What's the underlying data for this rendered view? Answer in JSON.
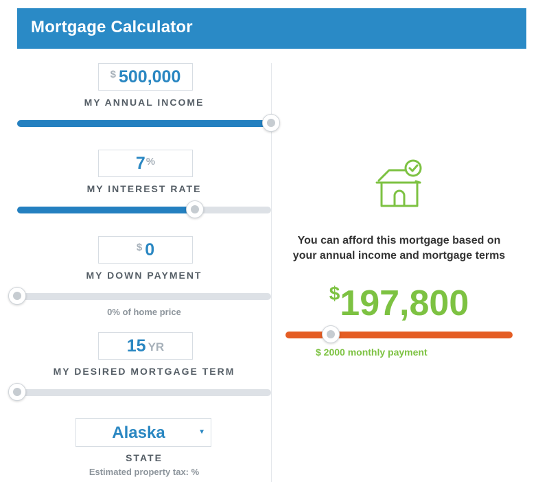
{
  "header": {
    "title": "Mortgage Calculator"
  },
  "colors": {
    "primary": "#2a8ac6",
    "slider_fill": "#2480c0",
    "track": "#dde1e6",
    "success": "#7dc242",
    "orange": "#e45d24",
    "value_blue": "#2a87c2"
  },
  "income": {
    "prefix": "$",
    "value": "500,000",
    "label": "MY ANNUAL INCOME",
    "slider_fraction": 1.0
  },
  "interest": {
    "value": "7",
    "suffix": "%",
    "label": "MY INTEREST RATE",
    "slider_fraction": 0.7
  },
  "down_payment": {
    "prefix": "$",
    "value": "0",
    "label": "MY DOWN PAYMENT",
    "note": "0% of home price",
    "slider_fraction": 0.0
  },
  "term": {
    "value": "15",
    "suffix": "YR",
    "label": "MY DESIRED MORTGAGE TERM",
    "slider_fraction": 0.0
  },
  "state": {
    "selected": "Alaska",
    "label": "STATE",
    "note": "Estimated property tax: %"
  },
  "result": {
    "icon": "house-check-icon",
    "message_line1": "You can afford this mortgage based on",
    "message_line2": "your annual income and mortgage terms",
    "currency": "$",
    "amount": "197,800",
    "monthly": "$ 2000 monthly payment",
    "slider_fraction": 0.2
  }
}
